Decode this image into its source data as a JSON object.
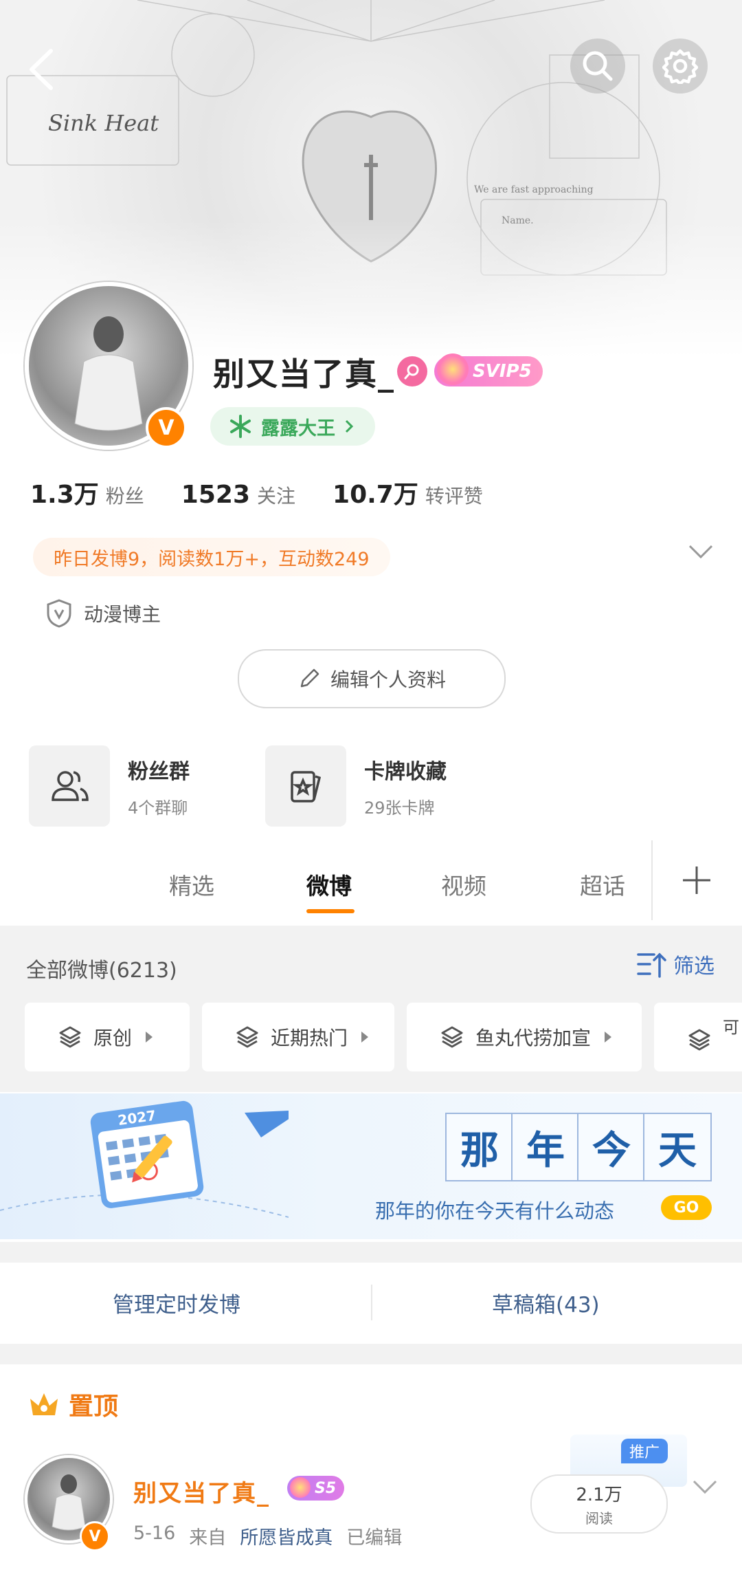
{
  "header": {
    "back_icon": "chevron-left-icon",
    "search_icon": "search-icon",
    "settings_icon": "gear-icon"
  },
  "profile": {
    "username": "别又当了真_",
    "svip_label": "SVIP5",
    "fan_badge": "露露大王",
    "stats": [
      {
        "value": "1.3万",
        "label": "粉丝"
      },
      {
        "value": "1523",
        "label": "关注"
      },
      {
        "value": "10.7万",
        "label": "转评赞"
      }
    ],
    "activity": "昨日发博9，阅读数1万+，互动数249",
    "tag": "动漫博主",
    "edit_button": "编辑个人资料",
    "cards": [
      {
        "title": "粉丝群",
        "subtitle": "4个群聊"
      },
      {
        "title": "卡牌收藏",
        "subtitle": "29张卡牌"
      }
    ],
    "verified_badge": "V"
  },
  "tabs": [
    {
      "label": "精选"
    },
    {
      "label": "微博"
    },
    {
      "label": "视频"
    },
    {
      "label": "超话"
    }
  ],
  "feed": {
    "all_weibo": "全部微博(6213)",
    "filter_label": "筛选",
    "chips": [
      {
        "label": "原创"
      },
      {
        "label": "近期热门"
      },
      {
        "label": "鱼丸代捞加宣"
      },
      {
        "label": "可"
      }
    ]
  },
  "on_this_day": {
    "chars": [
      "那",
      "年",
      "今",
      "天"
    ],
    "subtitle": "那年的你在今天有什么动态",
    "go": "GO",
    "calendar_year": "2027"
  },
  "manage": {
    "scheduled": "管理定时发博",
    "drafts": "草稿箱(43)"
  },
  "pinned": {
    "label": "置顶",
    "user": "别又当了真_",
    "level": "S5",
    "date": "5-16",
    "from": "来自",
    "source": "所愿皆成真",
    "edited": "已编辑",
    "reads": "2.1万",
    "reads_label": "阅读",
    "promo": "推广"
  },
  "colors": {
    "accent_orange": "#f07a14",
    "link_blue": "#3e6fbd",
    "fan_green": "#3aa85a"
  }
}
